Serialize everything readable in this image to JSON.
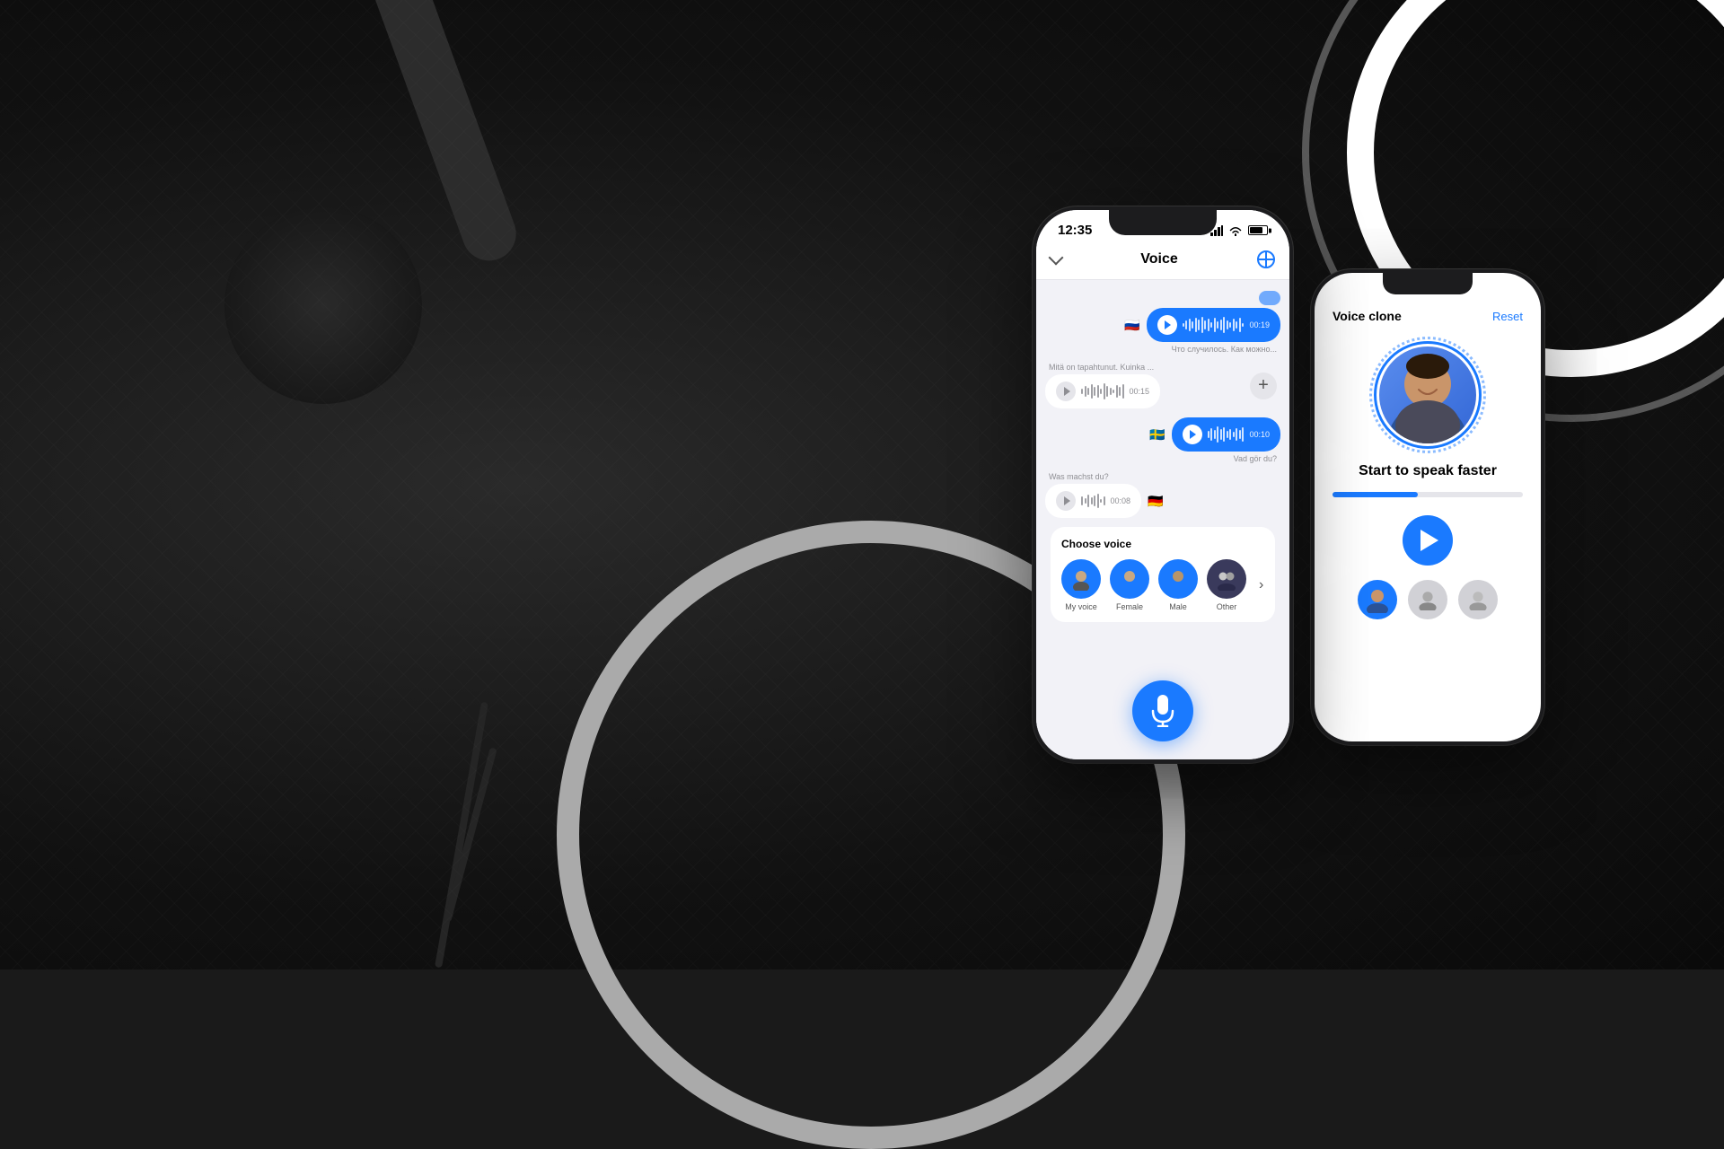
{
  "background": {
    "color": "#1a1a1a"
  },
  "phone1": {
    "status_time": "12:35",
    "header_title": "Voice",
    "messages": [
      {
        "side": "right",
        "label": "Что случилось. Как можно...",
        "duration": "00:19",
        "flag": "🇷🇺",
        "flag_side": "left",
        "type": "blue"
      },
      {
        "side": "left",
        "label": "Mitä on tapahtunut. Kuinka ...",
        "duration": "00:15",
        "flag": "",
        "type": "gray"
      },
      {
        "side": "right",
        "label": "Vad gör du?",
        "duration": "00:10",
        "flag": "🇸🇪",
        "flag_side": "left",
        "type": "blue"
      },
      {
        "side": "left",
        "label": "Was machst du?",
        "duration": "00:08",
        "flag": "🇩🇪",
        "flag_side": "right",
        "type": "gray"
      }
    ],
    "choose_voice": {
      "title": "Choose voice",
      "options": [
        "My voice",
        "Female",
        "Male",
        "Other"
      ]
    }
  },
  "phone2": {
    "header_title": "Voice clone",
    "reset_label": "Reset",
    "speak_faster_text": "Start to speak faster",
    "play_label": "Play",
    "speed_percent": 45,
    "avatar_count": 3
  }
}
